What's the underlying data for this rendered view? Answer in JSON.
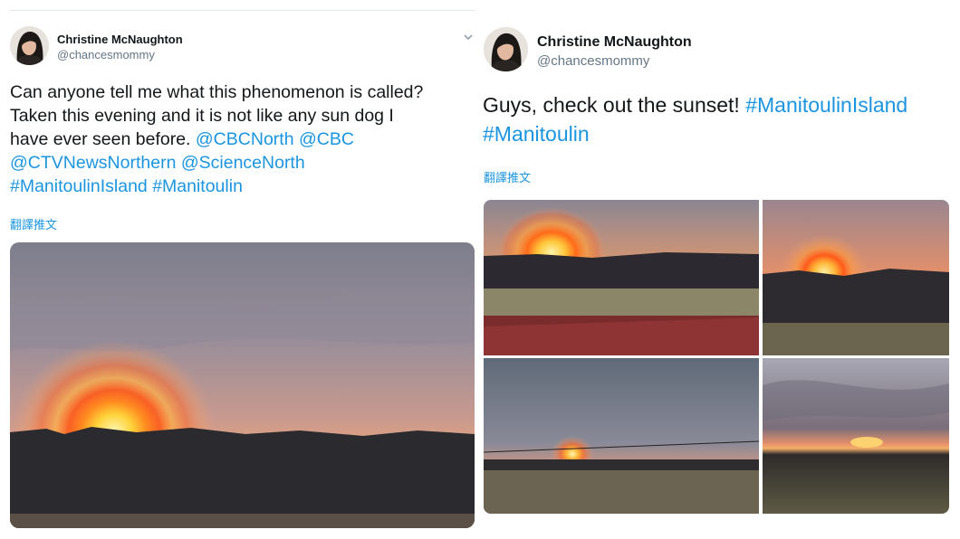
{
  "left_tweet": {
    "author_name": "Christine McNaughton",
    "author_handle": "@chancesmommy",
    "text_lines": [
      "Can anyone tell me what this phenomenon is called?",
      "Taken this evening and it is not like any sun dog I"
    ],
    "line3_text": "have ever seen before. ",
    "mention_cbcnorth": "@CBCNorth",
    "mention_cbc": "@CBC",
    "mention_ctv": "@CTVNewsNorthern",
    "mention_sciencenorth": "@ScienceNorth",
    "hashtag_manitoulinisland": "#ManitoulinIsland",
    "hashtag_manitoulin": "#Manitoulin",
    "translate_label": "翻譯推文"
  },
  "right_tweet": {
    "author_name": "Christine McNaughton",
    "author_handle": "@chancesmommy",
    "text_start": "Guys, check out the sunset! ",
    "hashtag_manitoulinisland": "#ManitoulinIsland",
    "hashtag_manitoulin": "#Manitoulin",
    "translate_label": "翻譯推文"
  },
  "icons": {
    "more_menu": "chevron-down-icon"
  },
  "colors": {
    "link": "#1b95e0",
    "text": "#14171a",
    "muted": "#657786"
  }
}
